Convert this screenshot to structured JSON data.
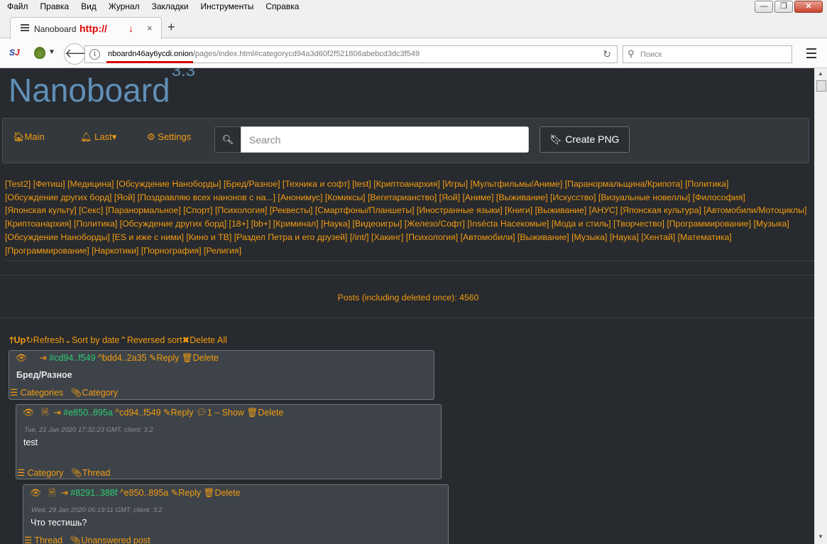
{
  "browser": {
    "menu": [
      "Файл",
      "Правка",
      "Вид",
      "Журнал",
      "Закладки",
      "Инструменты",
      "Справка"
    ],
    "window_buttons": {
      "minimize": "—",
      "maximize": "❐",
      "close": "✕"
    },
    "tab": {
      "title": "Nanoboard",
      "annotation": "http://",
      "arrow": "↓",
      "close": "×"
    },
    "new_tab": "+",
    "url": {
      "host": "nboardn46ay6ycdi.onion",
      "path": "/pages/index.html#categorycd94a3d60f2f521806abebcd3dc3f549"
    },
    "search_placeholder": "Поиск",
    "extension_label": "S",
    "extension_label_accent": "J"
  },
  "app": {
    "brand": "Nanoboard",
    "version": "3.3",
    "nav": {
      "main": "Main",
      "last": "Last",
      "settings": "Settings"
    },
    "search_placeholder": "Search",
    "create_png": "Create PNG",
    "categories": [
      "[Test2]",
      "[Фетиш]",
      "[Медицина]",
      "[Обсуждение Наноборды]",
      "[Бред/Разное]",
      "[Техника и софт]",
      "[test]",
      "[Криптоанархия]",
      "[Игры]",
      "[Мультфильмы/Аниме]",
      "[Паранормальщина/Крипота]",
      "[Политика]",
      "[Обсуждение других борд]",
      "[Яой]",
      "[Поздравляю всех нанонов с на...]",
      "[Анонимус]",
      "[Комиксы]",
      "[Вегетарианство]",
      "[Яой]",
      "[Аниме]",
      "[Выживание]",
      "[Искусство]",
      "[Визуальные новеллы]",
      "[Философия]",
      "[Японская культу]",
      "[Секс]",
      "[Паранормальное]",
      "[Спорт]",
      "[Психология]",
      "[Реквесты]",
      "[Смартфоны/Планшеты]",
      "[Иностранные языки]",
      "[Книги]",
      "[Выживание]",
      "[АНУС]",
      "[Японская культура]",
      "[Автомобили/Мотоциклы]",
      "[Криптоанархия]",
      "[Политика]",
      "[Обсуждение других борд]",
      "[18+]",
      "[bb+]",
      "[Криминал]",
      "[Наука]",
      "[Видеоигры]",
      "[Железо/Софт]",
      "[Insécta Насекомые]",
      "[Мода и стиль]",
      "[Творчество]",
      "[Программирование]",
      "[Музыка]",
      "[Обсуждение Наноборды]",
      "[ES и иже с ними]",
      "[Кино и ТВ]",
      "[Раздел Петра и его друзей]",
      "[/int/]",
      "[Хакинг]",
      "[Психология]",
      "[Автомобили]",
      "[Выживание]",
      "[Музыка]",
      "[Наука]",
      "[Хентай]",
      "[Математика]",
      "[Программирование]",
      "[Наркотики]",
      "[Порнография]",
      "[Религия]"
    ],
    "posts_count": "Posts (including deleted once): 4560",
    "toolbar": {
      "up": "Up",
      "refresh": "Refresh",
      "sort_date": "Sort by date",
      "reversed": "Reversed sort",
      "delete_all": "Delete All"
    },
    "posts": [
      {
        "hash": "#cd94..f549",
        "parent": "^bdd4..2a35",
        "reply": "Reply",
        "delete": "Delete",
        "body": "Бред/Разное",
        "foot1": "Categories",
        "foot2": "Category"
      },
      {
        "hash": "#e850..895a",
        "parent": "^cd94..f549",
        "reply": "Reply",
        "show": "1 – Show",
        "delete": "Delete",
        "meta": "Tue, 21 Jan 2020 17:32:23 GMT, client: 3.2",
        "body": "test",
        "foot1": "Category",
        "foot2": "Thread"
      },
      {
        "hash": "#8291..388f",
        "parent": "^e850..895a",
        "reply": "Reply",
        "delete": "Delete",
        "meta": "Wed, 29 Jan 2020 05:19:11 GMT, client: 3.2",
        "body": "Что тестишь?",
        "foot1": "Thread",
        "foot2": "Unanswered post"
      }
    ]
  },
  "colors": {
    "accent": "#f39c12",
    "hash": "#2ecc71",
    "brand": "#5f8fb7",
    "page_bg": "#272a2e",
    "post_bg": "#3d4349"
  }
}
